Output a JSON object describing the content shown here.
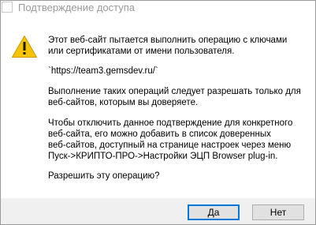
{
  "window": {
    "title": "Подтверждение доступа"
  },
  "icons": {
    "title_icon": "blank-window-icon",
    "message_icon": "warning-icon",
    "warning_color": "#f6c400"
  },
  "message": {
    "lines": [
      "Этот веб-сайт пытается выполнить операцию с ключами",
      "или сертификатами от имени пользователя.",
      "`https://team3.gemsdev.ru/`",
      "Выполнение таких операций следует разрешать только для",
      "веб-сайтов, которым вы доверяете.",
      "Чтобы отключить данное подтверждение для конкретного",
      "веб-сайта, его можно добавить в список доверенных",
      "веб-сайтов, доступный на странице настроек через меню",
      "Пуск->КРИПТО-ПРО->Настройки ЭЦП Browser plug-in.",
      "Разрешить эту операцию?"
    ]
  },
  "buttons": {
    "yes_label": "Да",
    "no_label": "Нет",
    "accent": "#0078d7"
  }
}
